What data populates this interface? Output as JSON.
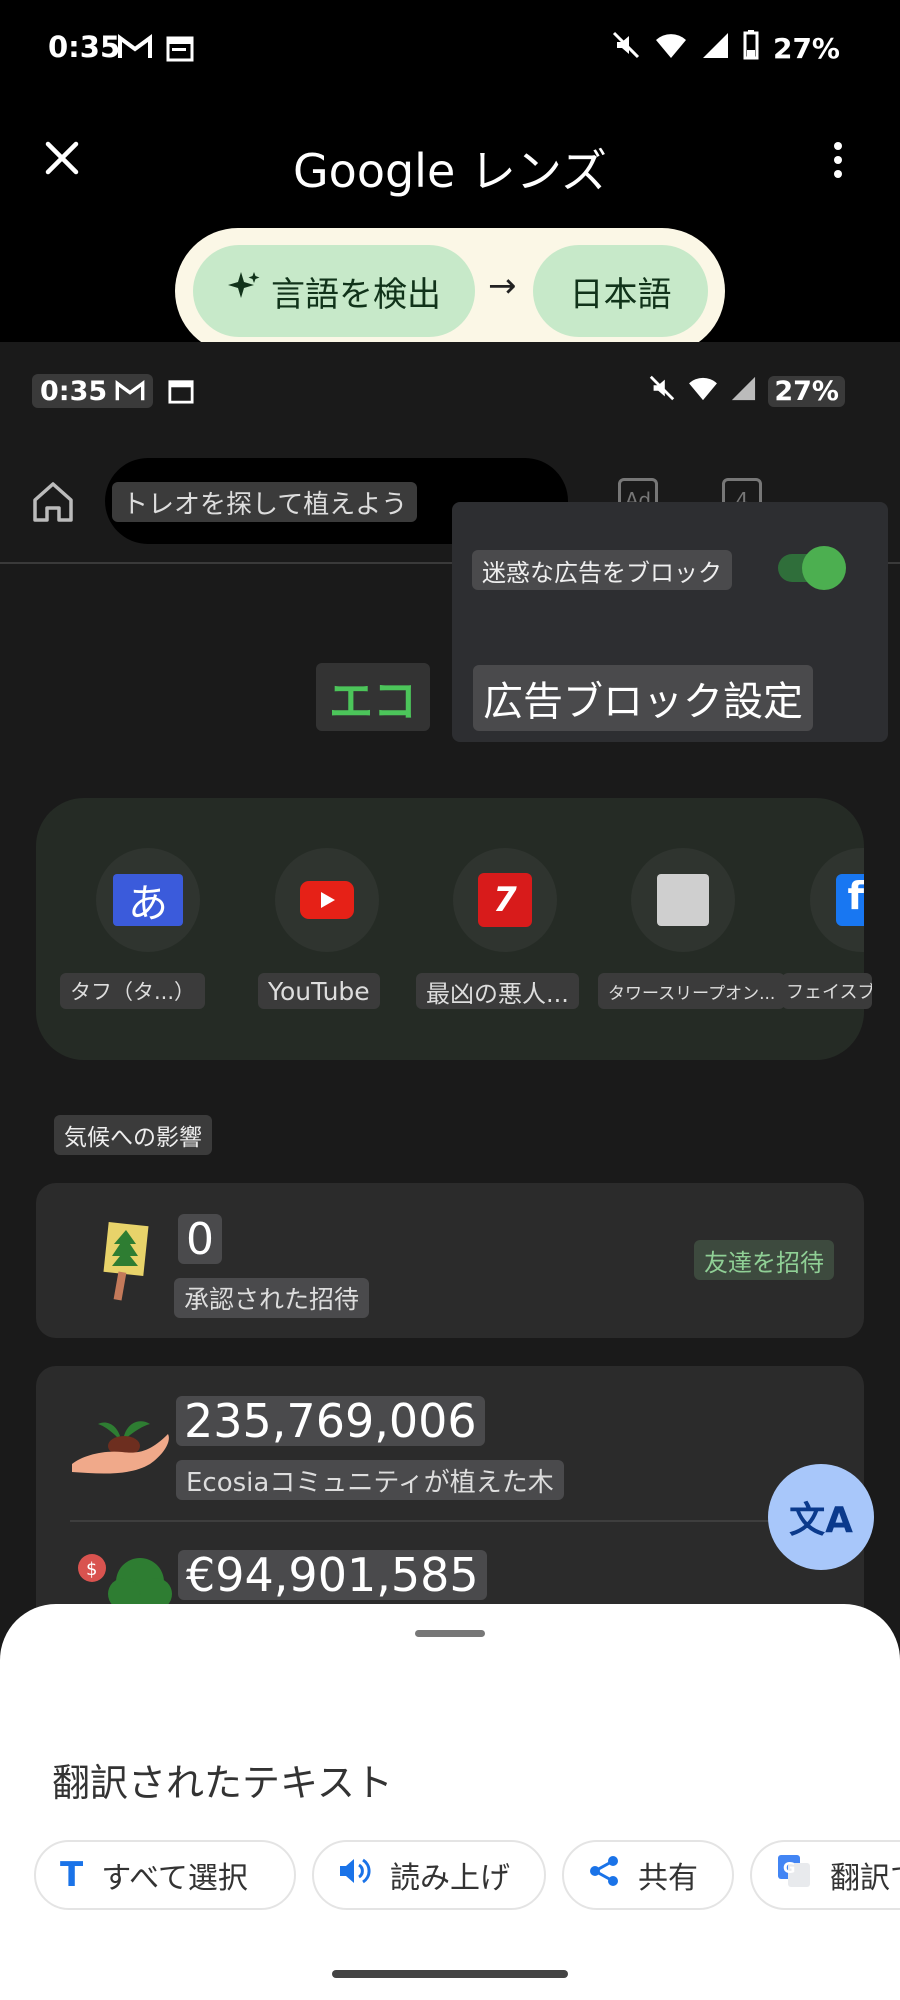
{
  "status_bar": {
    "time": "0:35",
    "battery": "27%"
  },
  "lens_header": {
    "title": "Google レンズ"
  },
  "language": {
    "source": "言語を検出",
    "arrow": "→",
    "target": "日本語"
  },
  "captured": {
    "status": {
      "time": "0:35",
      "battery": "27%"
    },
    "url_bar_text": "トレオを探して植えよう",
    "toolbar_badges": {
      "ads": "Ad",
      "tabs": "4"
    },
    "popup": {
      "toggle_label": "迷惑な広告をブロック",
      "toggle_on": true,
      "title": "広告ブロック設定"
    },
    "eco_title": "エコ",
    "shortcuts": [
      {
        "label": "タフ（タ...）",
        "icon": "あ"
      },
      {
        "label": "YouTube",
        "icon": "youtube"
      },
      {
        "label": "最凶の悪人...",
        "icon": "7"
      },
      {
        "label": "タワースリープオン...",
        "icon": "thumbnail"
      },
      {
        "label": "フェイスブ",
        "icon": "f"
      }
    ],
    "section_label": "気候への影響",
    "impact_card": {
      "value": "0",
      "label": "承認された招待",
      "action": "友達を招待"
    },
    "trees_card": {
      "value": "235,769,006",
      "label": "Ecosiaコミュニティが植えた木",
      "money_value": "€94,901,585"
    },
    "fab_icon": "文A"
  },
  "sheet": {
    "title": "翻訳されたテキスト",
    "chips": [
      {
        "icon": "T",
        "label": "すべて選択"
      },
      {
        "icon": "🔊",
        "label": "読み上げ"
      },
      {
        "icon": "⋖",
        "label": "共有"
      },
      {
        "icon": "G",
        "label": "翻訳で"
      }
    ]
  },
  "colors": {
    "accent_green": "#4caf50",
    "chip_blue": "#1a73e8",
    "fab": "#a8c7fa",
    "lang_pill": "#c7e9c9"
  }
}
